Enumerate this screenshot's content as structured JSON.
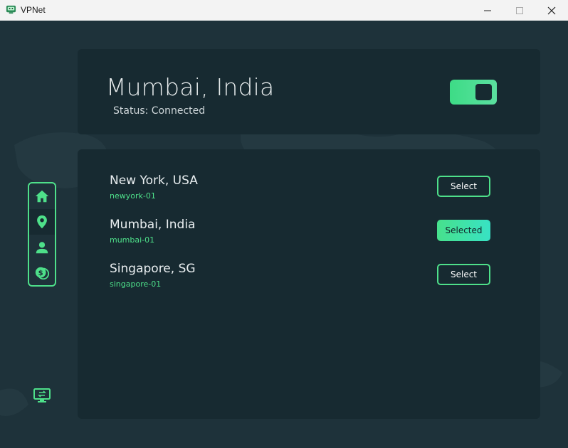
{
  "window": {
    "title": "VPNet",
    "controls": [
      "minimize-icon",
      "maximize-icon",
      "close-icon"
    ]
  },
  "colors": {
    "accent": "#4ee08a",
    "background": "#1e323a",
    "card": "#172a31",
    "text": "#eef2f3"
  },
  "sidebar": {
    "items": [
      {
        "icon": "home-icon",
        "active": false
      },
      {
        "icon": "location-pin-icon",
        "active": true
      },
      {
        "icon": "user-icon",
        "active": false
      },
      {
        "icon": "coins-icon",
        "active": false
      }
    ],
    "bottom_icon": "monitor-switch-icon"
  },
  "connection": {
    "location": "Mumbai, India",
    "status": "Status: Connected",
    "toggle_on": true
  },
  "servers": [
    {
      "name": "New York, USA",
      "id": "newyork-01",
      "button": "Select",
      "selected": false
    },
    {
      "name": "Mumbai, India",
      "id": "mumbai-01",
      "button": "Selected",
      "selected": true
    },
    {
      "name": "Singapore, SG",
      "id": "singapore-01",
      "button": "Select",
      "selected": false
    }
  ]
}
